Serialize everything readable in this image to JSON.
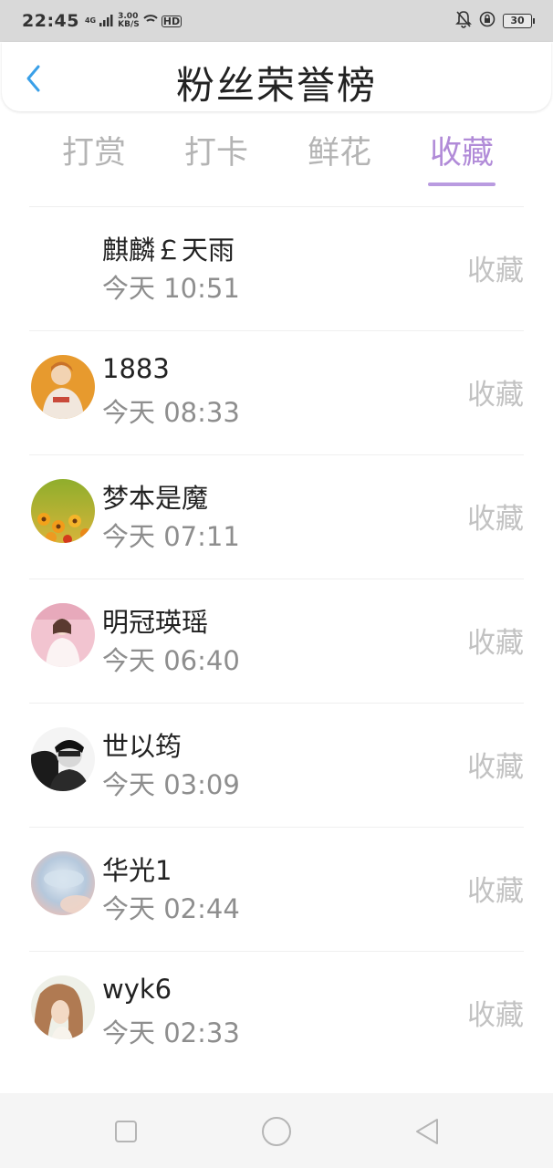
{
  "status_bar": {
    "time": "22:45",
    "network": "4G",
    "speed_value": "3.00",
    "speed_unit": "KB/S",
    "hd_label": "HD",
    "battery": "30"
  },
  "header": {
    "title": "粉丝荣誉榜",
    "back_icon": "chevron-left-icon"
  },
  "tabs": [
    {
      "label": "打赏",
      "active": false
    },
    {
      "label": "打卡",
      "active": false
    },
    {
      "label": "鲜花",
      "active": false
    },
    {
      "label": "收藏",
      "active": true
    }
  ],
  "list": [
    {
      "name": "麒麟￡天雨",
      "time": "今天 10:51",
      "action": "收藏",
      "avatar": "none"
    },
    {
      "name": "1883",
      "time": "今天 08:33",
      "action": "收藏",
      "avatar": "girl-orange"
    },
    {
      "name": "梦本是魔",
      "time": "今天 07:11",
      "action": "收藏",
      "avatar": "flowers"
    },
    {
      "name": "明冠瑛瑶",
      "time": "今天 06:40",
      "action": "收藏",
      "avatar": "girl-pink"
    },
    {
      "name": "世以筠",
      "time": "今天 03:09",
      "action": "收藏",
      "avatar": "bw-portrait"
    },
    {
      "name": "华光1",
      "time": "今天 02:44",
      "action": "收藏",
      "avatar": "pastel-blur"
    },
    {
      "name": "wyk6",
      "time": "今天 02:33",
      "action": "收藏",
      "avatar": "girl-hair"
    }
  ],
  "nav": {
    "recent_icon": "square-icon",
    "home_icon": "circle-icon",
    "back_icon": "triangle-back-icon"
  },
  "colors": {
    "accent": "#b18bd8",
    "back_arrow": "#3aa0e8",
    "inactive_tab": "#b4b4b4",
    "secondary_text": "#8e8e8e"
  }
}
